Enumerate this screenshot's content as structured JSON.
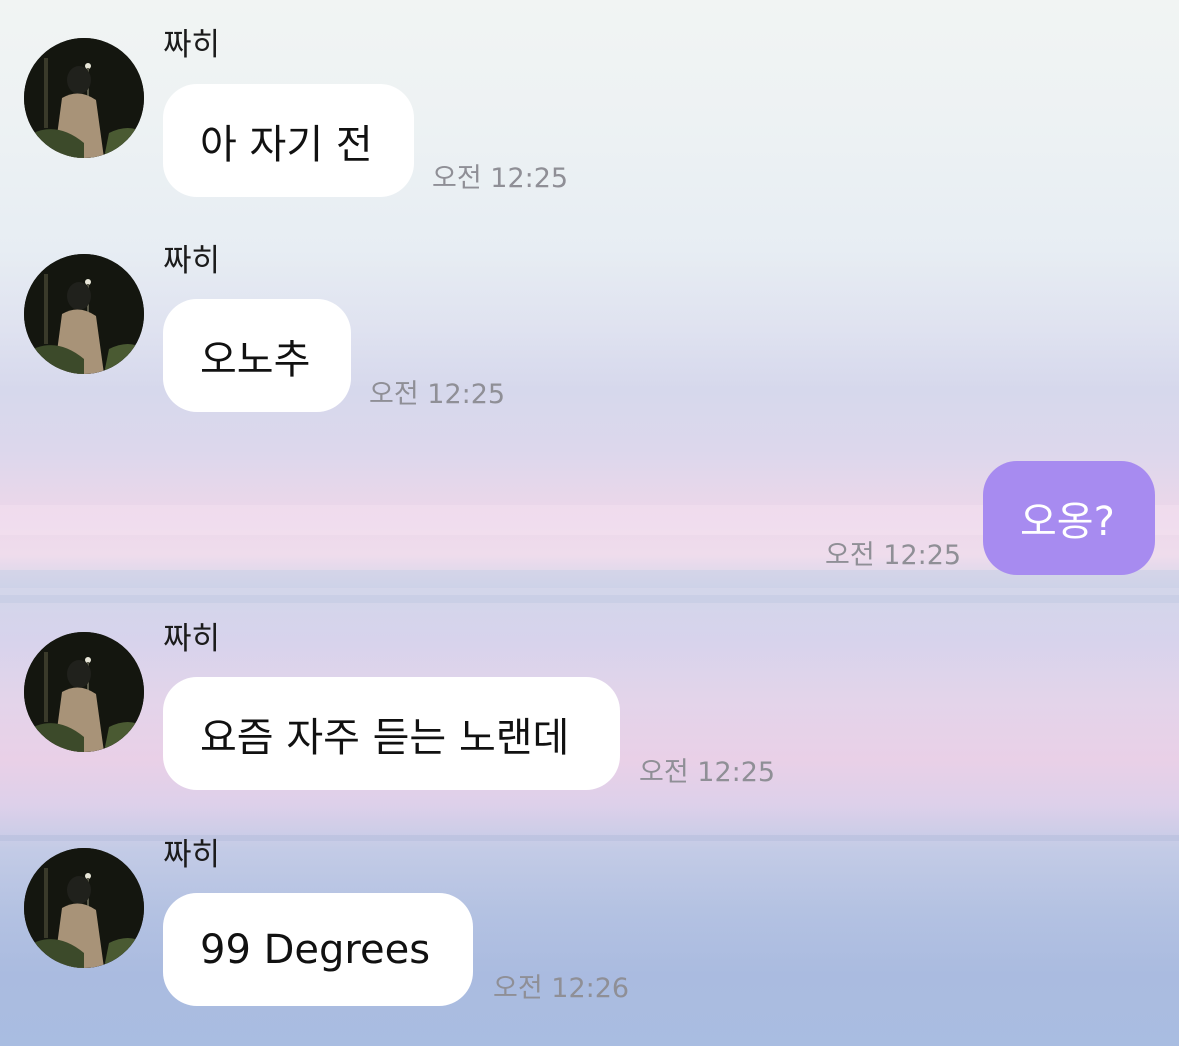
{
  "colors": {
    "incoming_bubble": "#ffffff",
    "outgoing_bubble": "#a78bf0",
    "timestamp": "#8f8f96"
  },
  "messages": [
    {
      "direction": "incoming",
      "sender": "짜히",
      "text": "아 자기 전",
      "time": "오전 12:25",
      "avatar_icon": "profile-photo"
    },
    {
      "direction": "incoming",
      "sender": "짜히",
      "text": "오노추",
      "time": "오전 12:25",
      "avatar_icon": "profile-photo"
    },
    {
      "direction": "outgoing",
      "text": "오옹?",
      "time": "오전 12:25"
    },
    {
      "direction": "incoming",
      "sender": "짜히",
      "text": "요즘 자주 듣는 노랜데",
      "time": "오전 12:25",
      "avatar_icon": "profile-photo"
    },
    {
      "direction": "incoming",
      "sender": "짜히",
      "text": "99 Degrees",
      "time": "오전 12:26",
      "avatar_icon": "profile-photo"
    }
  ]
}
